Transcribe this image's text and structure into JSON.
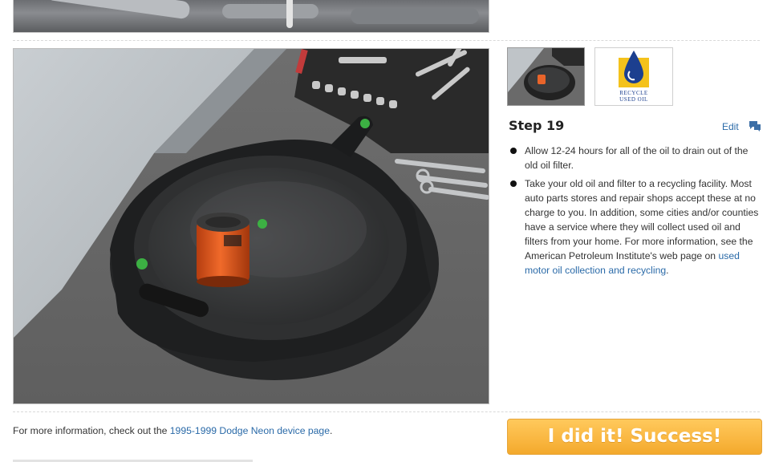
{
  "step": {
    "title": "Step 19",
    "edit_label": "Edit",
    "bullets": [
      {
        "text": "Allow 12-24 hours for all of the oil to drain out of the old oil filter."
      },
      {
        "text_before": "Take your old oil and filter to a recycling facility. Most auto parts stores and repair shops accept these at no charge to you. In addition, some cities and/or counties have a service where they will collect used oil and filters from your home. For more information, see the American Petroleum Institute's web page on ",
        "link": "used motor oil collection and recycling",
        "text_after": "."
      }
    ]
  },
  "thumbnails": {
    "recycle_logo": {
      "line1": "RECYCLE",
      "line2": "USED OIL"
    }
  },
  "footer": {
    "info_prefix": "For more information, check out the ",
    "device_link": "1995-1999 Dodge Neon device page",
    "info_suffix": ".",
    "success_label": "I did it! Success!"
  },
  "colors": {
    "link": "#2a6aa8",
    "success_button": "#f9b640",
    "logo_blue": "#1c3f8f",
    "logo_yellow": "#f4c21b"
  },
  "icons": {
    "comment": "comment-icon",
    "bullet": "bullet-dot-icon"
  }
}
